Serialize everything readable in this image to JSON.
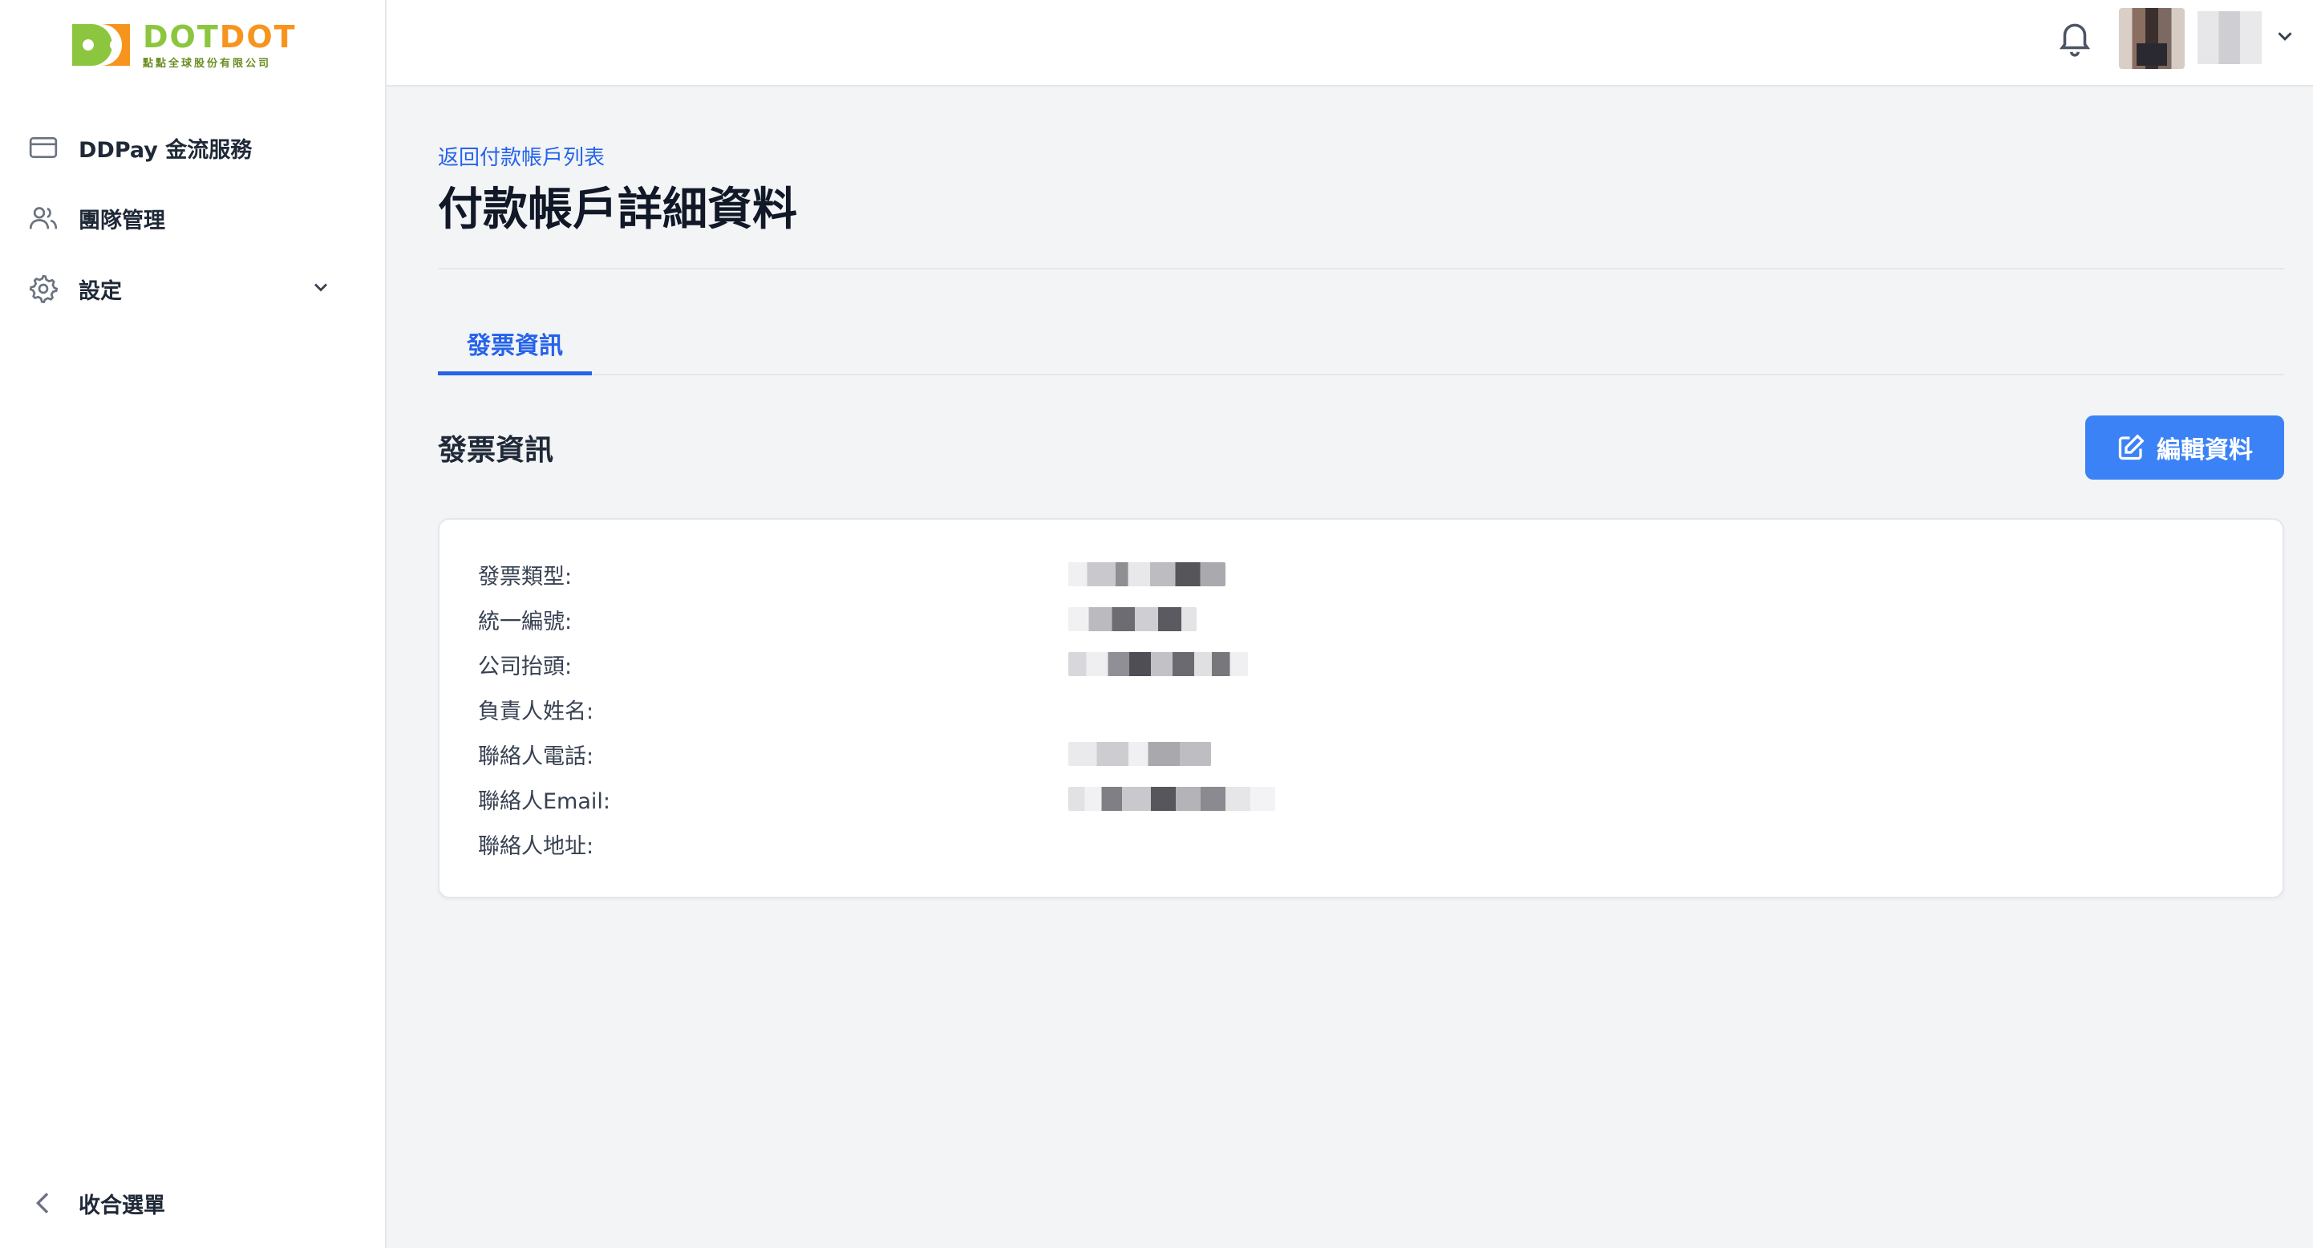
{
  "brand": {
    "logo_word_1": "DOT",
    "logo_word_2": "DOT",
    "logo_subtitle": "點點全球股份有限公司",
    "colors": {
      "green": "#8cc63f",
      "orange": "#f7941d"
    }
  },
  "sidebar": {
    "items": [
      {
        "label": "DDPay 金流服務",
        "icon": "credit-card-icon"
      },
      {
        "label": "團隊管理",
        "icon": "users-icon"
      },
      {
        "label": "設定",
        "icon": "gear-icon",
        "expandable": true
      }
    ],
    "collapse_label": "收合選單"
  },
  "topbar": {
    "notification_icon": "bell-icon",
    "user_name": "████"
  },
  "page": {
    "back_link": "返回付款帳戶列表",
    "title": "付款帳戶詳細資料",
    "tabs": [
      {
        "label": "發票資訊",
        "active": true
      }
    ],
    "section_title": "發票資訊",
    "edit_button": "編輯資料",
    "accent_color": "#3b82f6"
  },
  "invoice": {
    "rows": [
      {
        "label": "發票類型:",
        "value": "██████"
      },
      {
        "label": "統一編號:",
        "value": "████████"
      },
      {
        "label": "公司抬頭:",
        "value": "████████"
      },
      {
        "label": "負責人姓名:",
        "value": ""
      },
      {
        "label": "聯絡人電話:",
        "value": "██████████"
      },
      {
        "label": "聯絡人Email:",
        "value": "████████████"
      },
      {
        "label": "聯絡人地址:",
        "value": ""
      }
    ]
  }
}
